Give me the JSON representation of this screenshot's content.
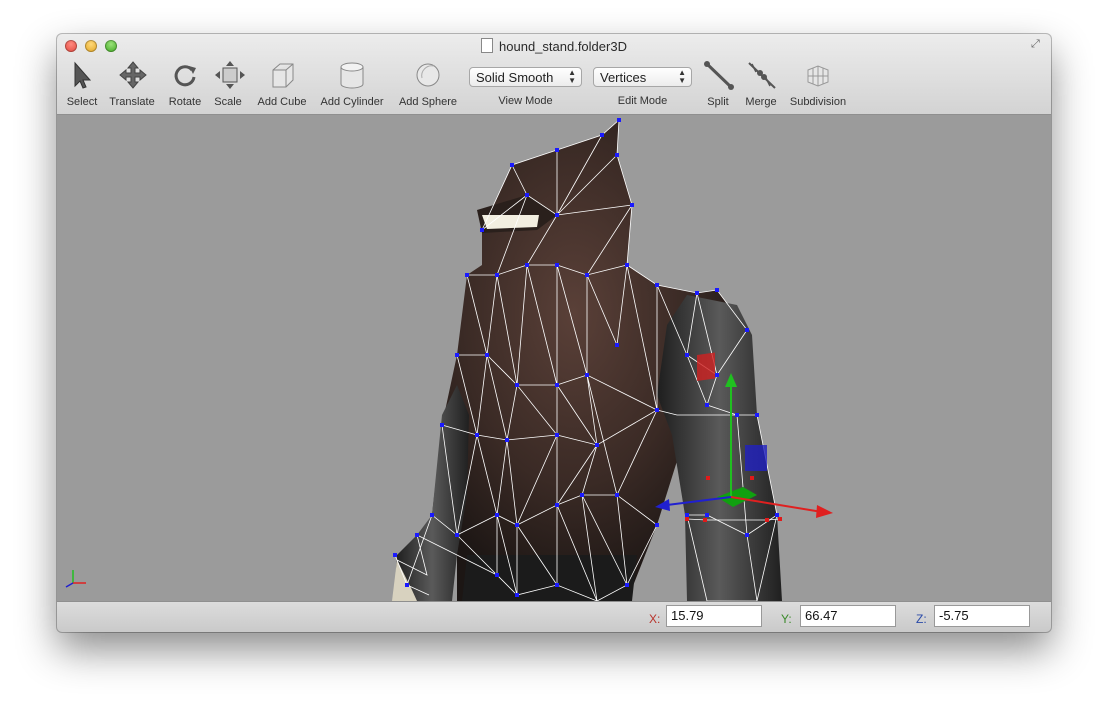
{
  "window": {
    "title": "hound_stand.folder3D"
  },
  "toolbar": {
    "tools": [
      {
        "label": "Select",
        "icon": "select-arrow-icon"
      },
      {
        "label": "Translate",
        "icon": "translate-arrows-icon"
      },
      {
        "label": "Rotate",
        "icon": "rotate-icon"
      },
      {
        "label": "Scale",
        "icon": "scale-icon"
      },
      {
        "label": "Add Cube",
        "icon": "cube-icon"
      },
      {
        "label": "Add Cylinder",
        "icon": "cylinder-icon"
      },
      {
        "label": "Add Sphere",
        "icon": "sphere-icon"
      },
      {
        "label": "Split",
        "icon": "split-icon"
      },
      {
        "label": "Merge",
        "icon": "merge-icon"
      },
      {
        "label": "Subdivision",
        "icon": "subdivision-icon"
      }
    ],
    "view_mode": {
      "label": "View Mode",
      "value": "Solid Smooth"
    },
    "edit_mode": {
      "label": "Edit Mode",
      "value": "Vertices"
    }
  },
  "status": {
    "x": {
      "label": "X:",
      "value": "15.79",
      "color": "#b8322a"
    },
    "y": {
      "label": "Y:",
      "value": "66.47",
      "color": "#3a8a2a"
    },
    "z": {
      "label": "Z:",
      "value": "-5.75",
      "color": "#2a4aa8"
    }
  },
  "colors": {
    "vertex": "#1a1aff",
    "selected_vertex": "#e01a1a",
    "wire": "#ffffff",
    "axis_x": "#e02020",
    "axis_y": "#20c020",
    "axis_z": "#2020d0"
  }
}
